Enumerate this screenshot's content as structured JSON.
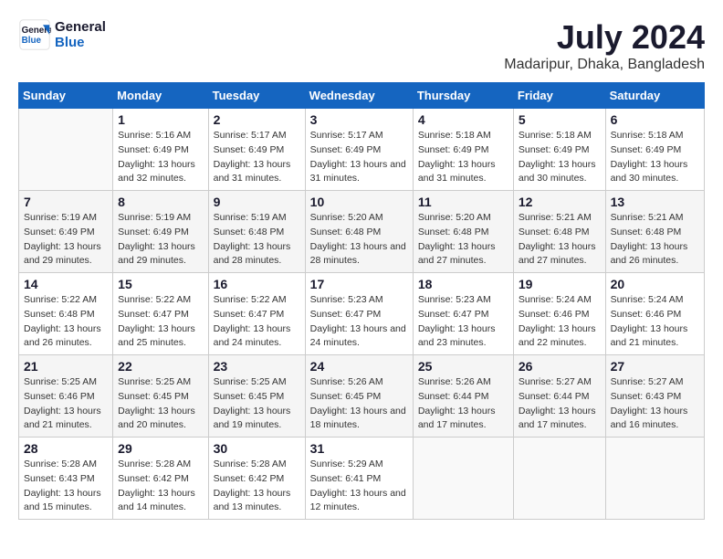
{
  "header": {
    "logo_line1": "General",
    "logo_line2": "Blue",
    "month_year": "July 2024",
    "location": "Madaripur, Dhaka, Bangladesh"
  },
  "weekdays": [
    "Sunday",
    "Monday",
    "Tuesday",
    "Wednesday",
    "Thursday",
    "Friday",
    "Saturday"
  ],
  "weeks": [
    [
      {
        "day": "",
        "sunrise": "",
        "sunset": "",
        "daylight": ""
      },
      {
        "day": "1",
        "sunrise": "Sunrise: 5:16 AM",
        "sunset": "Sunset: 6:49 PM",
        "daylight": "Daylight: 13 hours and 32 minutes."
      },
      {
        "day": "2",
        "sunrise": "Sunrise: 5:17 AM",
        "sunset": "Sunset: 6:49 PM",
        "daylight": "Daylight: 13 hours and 31 minutes."
      },
      {
        "day": "3",
        "sunrise": "Sunrise: 5:17 AM",
        "sunset": "Sunset: 6:49 PM",
        "daylight": "Daylight: 13 hours and 31 minutes."
      },
      {
        "day": "4",
        "sunrise": "Sunrise: 5:18 AM",
        "sunset": "Sunset: 6:49 PM",
        "daylight": "Daylight: 13 hours and 31 minutes."
      },
      {
        "day": "5",
        "sunrise": "Sunrise: 5:18 AM",
        "sunset": "Sunset: 6:49 PM",
        "daylight": "Daylight: 13 hours and 30 minutes."
      },
      {
        "day": "6",
        "sunrise": "Sunrise: 5:18 AM",
        "sunset": "Sunset: 6:49 PM",
        "daylight": "Daylight: 13 hours and 30 minutes."
      }
    ],
    [
      {
        "day": "7",
        "sunrise": "Sunrise: 5:19 AM",
        "sunset": "Sunset: 6:49 PM",
        "daylight": "Daylight: 13 hours and 29 minutes."
      },
      {
        "day": "8",
        "sunrise": "Sunrise: 5:19 AM",
        "sunset": "Sunset: 6:49 PM",
        "daylight": "Daylight: 13 hours and 29 minutes."
      },
      {
        "day": "9",
        "sunrise": "Sunrise: 5:19 AM",
        "sunset": "Sunset: 6:48 PM",
        "daylight": "Daylight: 13 hours and 28 minutes."
      },
      {
        "day": "10",
        "sunrise": "Sunrise: 5:20 AM",
        "sunset": "Sunset: 6:48 PM",
        "daylight": "Daylight: 13 hours and 28 minutes."
      },
      {
        "day": "11",
        "sunrise": "Sunrise: 5:20 AM",
        "sunset": "Sunset: 6:48 PM",
        "daylight": "Daylight: 13 hours and 27 minutes."
      },
      {
        "day": "12",
        "sunrise": "Sunrise: 5:21 AM",
        "sunset": "Sunset: 6:48 PM",
        "daylight": "Daylight: 13 hours and 27 minutes."
      },
      {
        "day": "13",
        "sunrise": "Sunrise: 5:21 AM",
        "sunset": "Sunset: 6:48 PM",
        "daylight": "Daylight: 13 hours and 26 minutes."
      }
    ],
    [
      {
        "day": "14",
        "sunrise": "Sunrise: 5:22 AM",
        "sunset": "Sunset: 6:48 PM",
        "daylight": "Daylight: 13 hours and 26 minutes."
      },
      {
        "day": "15",
        "sunrise": "Sunrise: 5:22 AM",
        "sunset": "Sunset: 6:47 PM",
        "daylight": "Daylight: 13 hours and 25 minutes."
      },
      {
        "day": "16",
        "sunrise": "Sunrise: 5:22 AM",
        "sunset": "Sunset: 6:47 PM",
        "daylight": "Daylight: 13 hours and 24 minutes."
      },
      {
        "day": "17",
        "sunrise": "Sunrise: 5:23 AM",
        "sunset": "Sunset: 6:47 PM",
        "daylight": "Daylight: 13 hours and 24 minutes."
      },
      {
        "day": "18",
        "sunrise": "Sunrise: 5:23 AM",
        "sunset": "Sunset: 6:47 PM",
        "daylight": "Daylight: 13 hours and 23 minutes."
      },
      {
        "day": "19",
        "sunrise": "Sunrise: 5:24 AM",
        "sunset": "Sunset: 6:46 PM",
        "daylight": "Daylight: 13 hours and 22 minutes."
      },
      {
        "day": "20",
        "sunrise": "Sunrise: 5:24 AM",
        "sunset": "Sunset: 6:46 PM",
        "daylight": "Daylight: 13 hours and 21 minutes."
      }
    ],
    [
      {
        "day": "21",
        "sunrise": "Sunrise: 5:25 AM",
        "sunset": "Sunset: 6:46 PM",
        "daylight": "Daylight: 13 hours and 21 minutes."
      },
      {
        "day": "22",
        "sunrise": "Sunrise: 5:25 AM",
        "sunset": "Sunset: 6:45 PM",
        "daylight": "Daylight: 13 hours and 20 minutes."
      },
      {
        "day": "23",
        "sunrise": "Sunrise: 5:25 AM",
        "sunset": "Sunset: 6:45 PM",
        "daylight": "Daylight: 13 hours and 19 minutes."
      },
      {
        "day": "24",
        "sunrise": "Sunrise: 5:26 AM",
        "sunset": "Sunset: 6:45 PM",
        "daylight": "Daylight: 13 hours and 18 minutes."
      },
      {
        "day": "25",
        "sunrise": "Sunrise: 5:26 AM",
        "sunset": "Sunset: 6:44 PM",
        "daylight": "Daylight: 13 hours and 17 minutes."
      },
      {
        "day": "26",
        "sunrise": "Sunrise: 5:27 AM",
        "sunset": "Sunset: 6:44 PM",
        "daylight": "Daylight: 13 hours and 17 minutes."
      },
      {
        "day": "27",
        "sunrise": "Sunrise: 5:27 AM",
        "sunset": "Sunset: 6:43 PM",
        "daylight": "Daylight: 13 hours and 16 minutes."
      }
    ],
    [
      {
        "day": "28",
        "sunrise": "Sunrise: 5:28 AM",
        "sunset": "Sunset: 6:43 PM",
        "daylight": "Daylight: 13 hours and 15 minutes."
      },
      {
        "day": "29",
        "sunrise": "Sunrise: 5:28 AM",
        "sunset": "Sunset: 6:42 PM",
        "daylight": "Daylight: 13 hours and 14 minutes."
      },
      {
        "day": "30",
        "sunrise": "Sunrise: 5:28 AM",
        "sunset": "Sunset: 6:42 PM",
        "daylight": "Daylight: 13 hours and 13 minutes."
      },
      {
        "day": "31",
        "sunrise": "Sunrise: 5:29 AM",
        "sunset": "Sunset: 6:41 PM",
        "daylight": "Daylight: 13 hours and 12 minutes."
      },
      {
        "day": "",
        "sunrise": "",
        "sunset": "",
        "daylight": ""
      },
      {
        "day": "",
        "sunrise": "",
        "sunset": "",
        "daylight": ""
      },
      {
        "day": "",
        "sunrise": "",
        "sunset": "",
        "daylight": ""
      }
    ]
  ]
}
